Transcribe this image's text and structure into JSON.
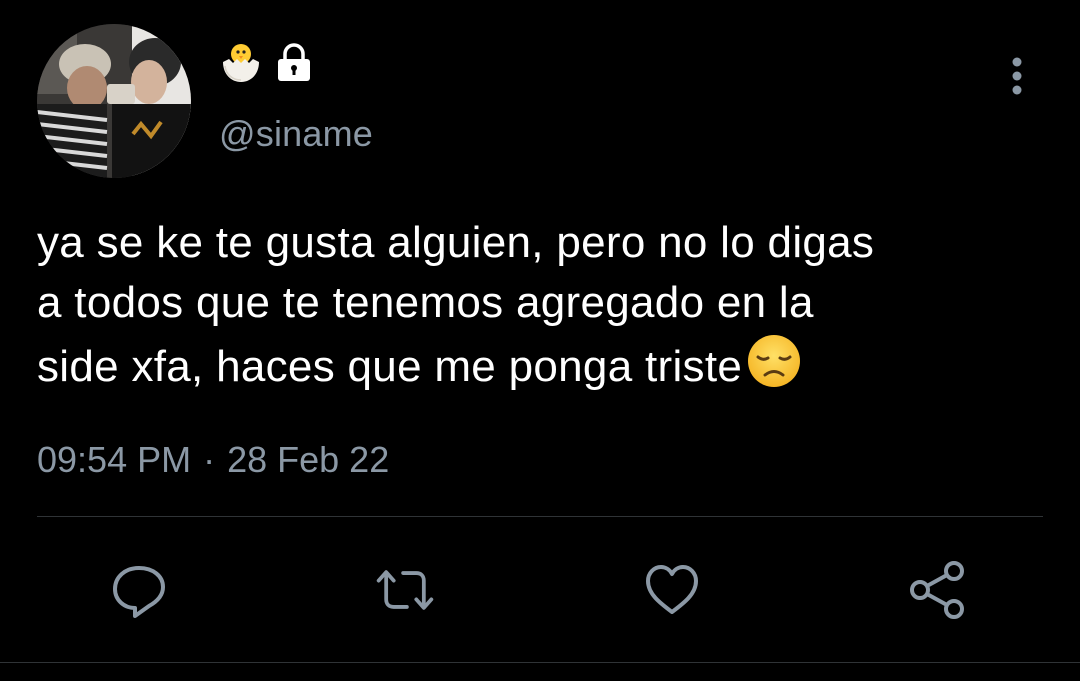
{
  "tweet": {
    "display_name_emojis": [
      "chick-hatching-icon",
      "lock-icon"
    ],
    "handle": "@siname",
    "text": "ya se ke te gusta alguien, pero no lo digas\na todos que te tenemos agregado en la\nside xfa, haces que me ponga triste",
    "text_emoji": "disappointed-face-icon",
    "time": "09:54 PM",
    "separator": "·",
    "date": "28 Feb 22"
  },
  "actions": [
    "reply-icon",
    "retweet-icon",
    "like-icon",
    "share-icon"
  ],
  "colors": {
    "background": "#000000",
    "text": "#ffffff",
    "secondary_text": "#8b98a5",
    "divider": "#2f3336",
    "icon": "#8b98a5"
  }
}
